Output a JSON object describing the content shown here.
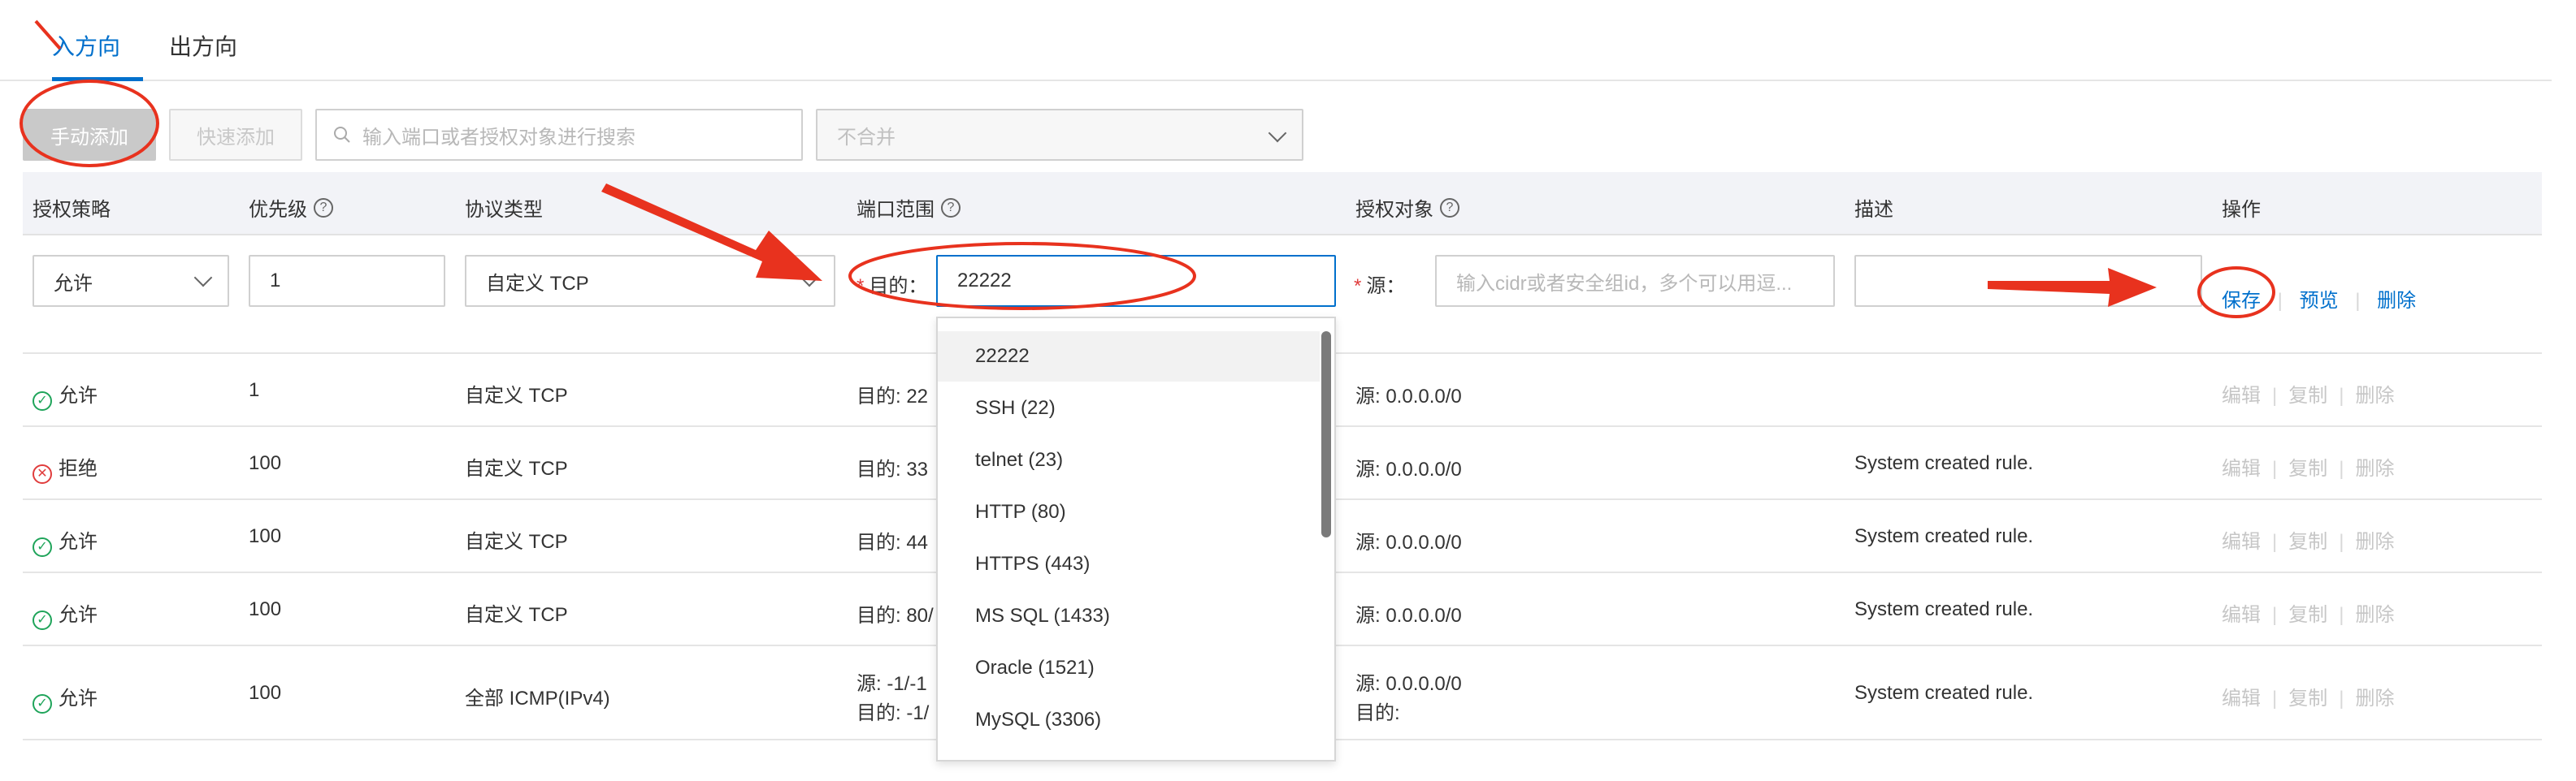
{
  "tabs": {
    "inbound": "入方向",
    "outbound": "出方向"
  },
  "toolbar": {
    "manual_add": "手动添加",
    "quick_add": "快速添加",
    "search_placeholder": "输入端口或者授权对象进行搜索",
    "merge_select": "不合并"
  },
  "columns": {
    "policy": "授权策略",
    "priority": "优先级",
    "protocol": "协议类型",
    "port_range": "端口范围",
    "auth_object": "授权对象",
    "description": "描述",
    "actions": "操作"
  },
  "edit_row": {
    "policy": "允许",
    "priority": "1",
    "protocol": "自定义 TCP",
    "dest_label": "目的：",
    "port_value": "22222",
    "source_label": "源：",
    "source_placeholder": "输入cidr或者安全组id，多个可以用逗...",
    "description": "",
    "save": "保存",
    "preview": "预览",
    "delete": "删除"
  },
  "port_dropdown": [
    "22222",
    "SSH (22)",
    "telnet (23)",
    "HTTP (80)",
    "HTTPS (443)",
    "MS SQL (1433)",
    "Oracle (1521)",
    "MySQL (3306)"
  ],
  "rows": [
    {
      "policy": "允许",
      "status": "ok",
      "priority": "1",
      "protocol": "自定义 TCP",
      "port": "目的: 22",
      "port2": "",
      "auth": "源: 0.0.0.0/0",
      "auth2": "",
      "desc": ""
    },
    {
      "policy": "拒绝",
      "status": "deny",
      "priority": "100",
      "protocol": "自定义 TCP",
      "port": "目的: 33",
      "port2": "",
      "auth": "源: 0.0.0.0/0",
      "auth2": "",
      "desc": "System created rule."
    },
    {
      "policy": "允许",
      "status": "ok",
      "priority": "100",
      "protocol": "自定义 TCP",
      "port": "目的: 44",
      "port2": "",
      "auth": "源: 0.0.0.0/0",
      "auth2": "",
      "desc": "System created rule."
    },
    {
      "policy": "允许",
      "status": "ok",
      "priority": "100",
      "protocol": "自定义 TCP",
      "port": "目的: 80/",
      "port2": "",
      "auth": "源: 0.0.0.0/0",
      "auth2": "",
      "desc": "System created rule."
    },
    {
      "policy": "允许",
      "status": "ok",
      "priority": "100",
      "protocol": "全部 ICMP(IPv4)",
      "port": "源: -1/-1",
      "port2": "目的: -1/",
      "auth": "源: 0.0.0.0/0",
      "auth2": "目的:",
      "desc": "System created rule."
    }
  ],
  "row_actions": {
    "edit": "编辑",
    "copy": "复制",
    "delete": "删除"
  },
  "colors": {
    "accent": "#0070cc",
    "annotation": "#e8321e",
    "allow": "#1fa45a",
    "deny": "#e03c3c"
  }
}
